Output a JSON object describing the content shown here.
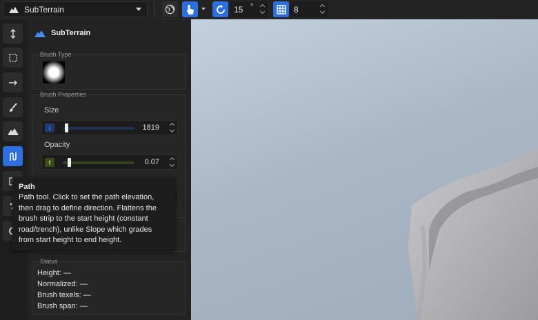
{
  "topbar": {
    "app_name": "SubTerrain",
    "rotation_value": "15",
    "rotation_unit": "°",
    "grid_value": "8"
  },
  "panel": {
    "title": "SubTerrain",
    "brush_type_label": "Brush Type",
    "brush_properties_label": "Brush Properties",
    "size": {
      "label": "Size",
      "badge": "i",
      "value": "1819",
      "fraction": 0.03
    },
    "opacity": {
      "label": "Opacity",
      "badge": "f",
      "value": "0.07",
      "fraction": 0.07
    },
    "status": {
      "label": "Status",
      "height": "Height: —",
      "normalized": "Normalized: —",
      "brush_texels": "Brush texels: —",
      "brush_span": "Brush span: —"
    }
  },
  "tooltip": {
    "title": "Path",
    "body": "Path tool. Click to set the path elevation, then drag to define direction. Flattens the brush strip to the start height (constant road/trench), unlike Slope which grades from start height to end height."
  },
  "left_toolbar": {
    "items": [
      "move-vertical-icon",
      "select-rect-icon",
      "line-arrow-icon",
      "brush-icon",
      "terrain-icon",
      "path-icon",
      "stamp-icon",
      "scatter-icon",
      "erase-icon"
    ]
  },
  "colors": {
    "accent": "#2e6fe0",
    "size_badge_bg": "#1f3a6e",
    "size_badge_fg": "#5b8fe8",
    "opacity_badge_bg": "#3a4a1a",
    "opacity_badge_fg": "#b6d35c"
  }
}
